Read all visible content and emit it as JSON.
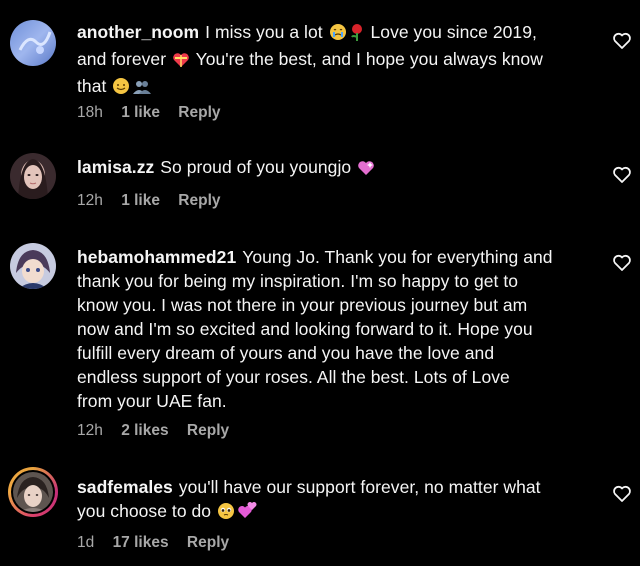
{
  "comments": [
    {
      "username": "another_noom",
      "text_part1": "I miss you a lot",
      "text_part2": "Love you since 2019,",
      "text_part3": "and forever",
      "text_part4": "You're the best, and I hope you always know",
      "text_part5": "that",
      "time": "18h",
      "likes": "1 like",
      "reply": "Reply",
      "emojis": [
        "crying-face",
        "rose",
        "heart-with-ribbon",
        "hugging-face",
        "busts-in-silhouette"
      ]
    },
    {
      "username": "lamisa.zz",
      "text": "So proud of you youngjo",
      "time": "12h",
      "likes": "1 like",
      "reply": "Reply",
      "emojis": [
        "sparkling-heart"
      ]
    },
    {
      "username": "hebamohammed21",
      "text_line1": "Young Jo. Thank you for everything and",
      "text_line2": "thank you for being my inspiration. I'm so happy to get to",
      "text_line3": "know you. I was not there in your previous journey but am",
      "text_line4": "now and I'm so excited and looking forward to it. Hope you",
      "text_line5": "fulfill every dream of yours and you have the love and",
      "text_line6": "endless support of your roses. All the best. Lots of Love",
      "text_line7": "from your UAE fan.",
      "time": "12h",
      "likes": "2 likes",
      "reply": "Reply"
    },
    {
      "username": "sadfemales",
      "text_line1": "you'll have our support forever, no matter what",
      "text_line2": "you choose to do",
      "time": "1d",
      "likes": "17 likes",
      "reply": "Reply",
      "emojis": [
        "pleading-face",
        "revolving-hearts"
      ]
    }
  ],
  "colors": {
    "background": "#000000",
    "text": "#f5f5f5",
    "meta": "#a8a8a8"
  },
  "icons": [
    "heart-outline-icon"
  ]
}
